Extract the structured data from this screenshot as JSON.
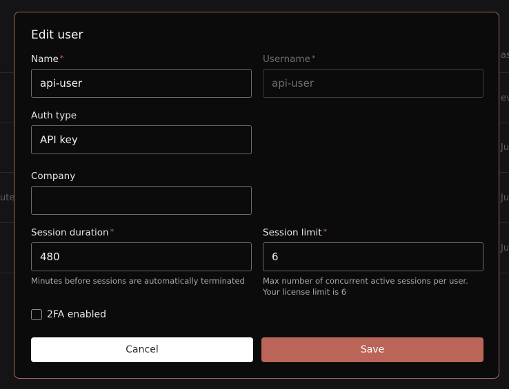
{
  "background": {
    "fragments": [
      "ast",
      "ev",
      "Ju",
      "ute",
      "Ju",
      "Ju"
    ]
  },
  "modal": {
    "title": "Edit user",
    "required_marker": "*",
    "name": {
      "label": "Name",
      "value": "api-user"
    },
    "username": {
      "label": "Username",
      "value": "api-user",
      "disabled": true
    },
    "auth_type": {
      "label": "Auth type",
      "value": "API key"
    },
    "company": {
      "label": "Company",
      "value": ""
    },
    "session_duration": {
      "label": "Session duration",
      "value": "480",
      "help": "Minutes before sessions are automatically terminated"
    },
    "session_limit": {
      "label": "Session limit",
      "value": "6",
      "help": "Max number of concurrent active sessions per user. Your license limit is 6"
    },
    "two_fa": {
      "label": "2FA enabled",
      "checked": false
    },
    "cancel_label": "Cancel",
    "save_label": "Save"
  },
  "colors": {
    "accent": "#bb6558",
    "modal_border": "#b0675a",
    "required": "#c2695a"
  }
}
